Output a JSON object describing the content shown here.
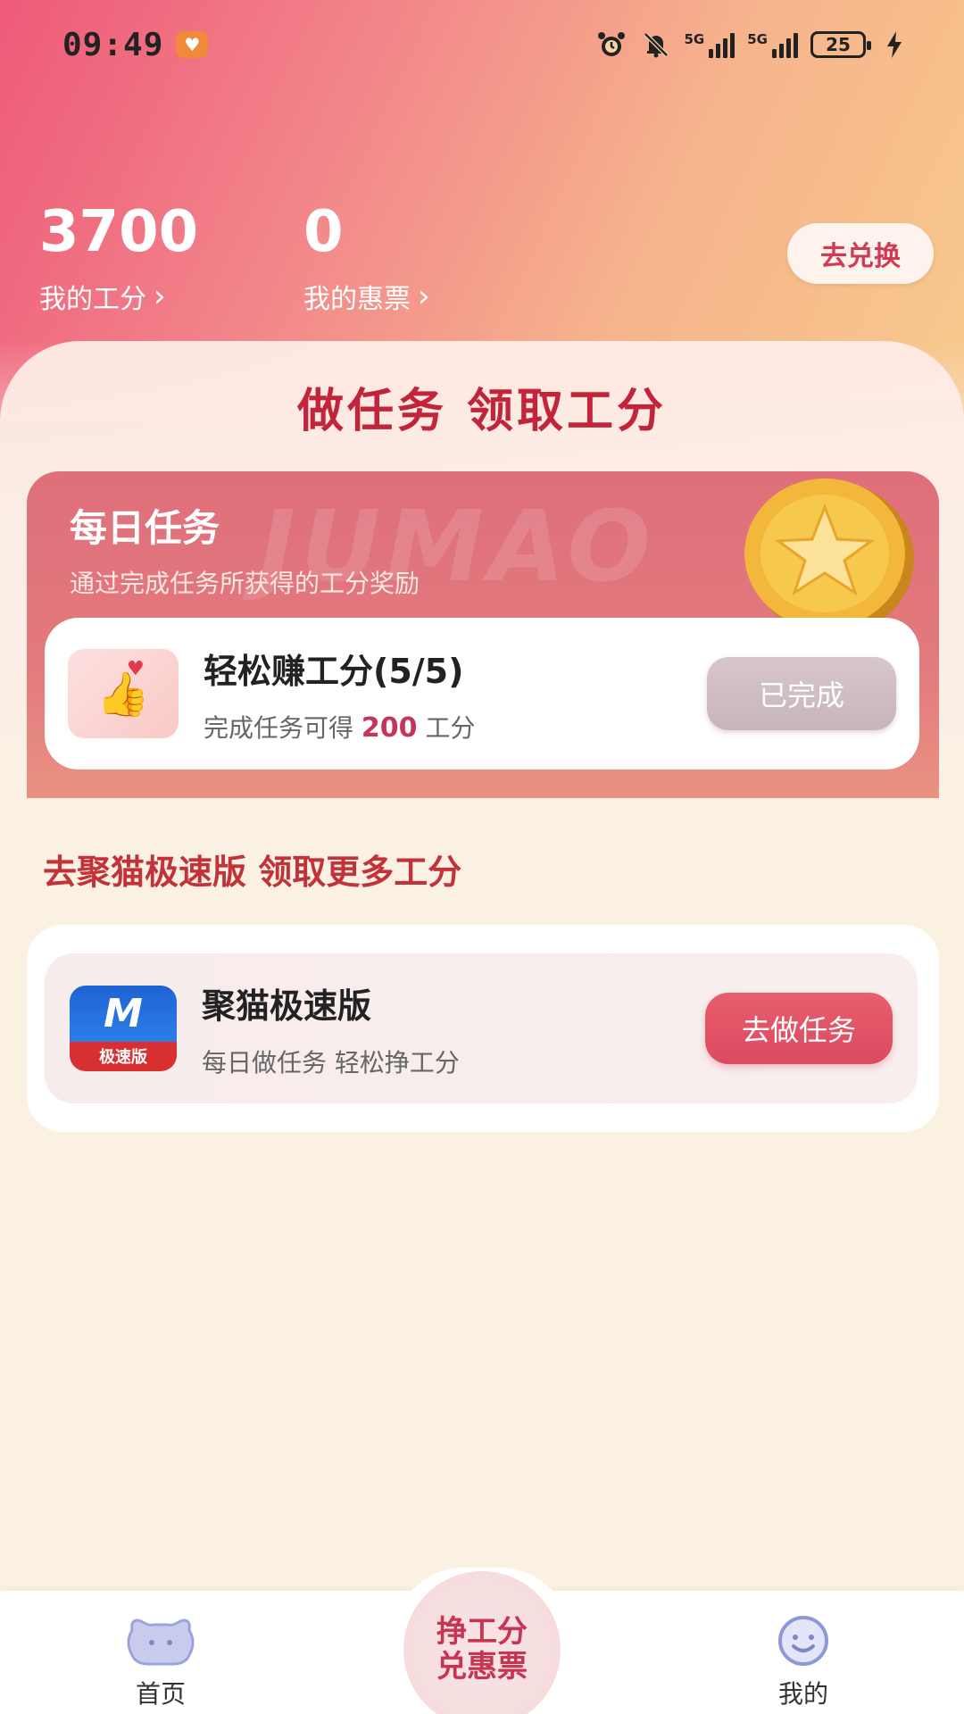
{
  "status_bar": {
    "time": "09:49",
    "network1": "5G",
    "network2": "5G",
    "battery": "25",
    "icons": [
      "alarm-icon",
      "mute-icon",
      "signal-icon",
      "battery-icon",
      "charging-icon"
    ]
  },
  "stats": {
    "work_points_value": "3700",
    "work_points_label": "我的工分",
    "tickets_value": "0",
    "tickets_label": "我的惠票",
    "exchange_button": "去兑换"
  },
  "main": {
    "title": "做任务 领取工分",
    "daily": {
      "title": "每日任务",
      "subtitle": "通过完成任务所获得的工分奖励",
      "watermark": "JUMAO"
    },
    "task": {
      "title": "轻松赚工分(5/5)",
      "desc_prefix": "完成任务可得",
      "points": "200",
      "desc_suffix": "工分",
      "button": "已完成"
    },
    "section_title": "去聚猫极速版 领取更多工分",
    "app": {
      "icon_letter": "M",
      "icon_tag": "极速版",
      "name": "聚猫极速版",
      "desc": "每日做任务 轻松挣工分",
      "button": "去做任务"
    }
  },
  "bottom_nav": {
    "home_label": "首页",
    "center_line1": "挣工分",
    "center_line2": "兑惠票",
    "mine_label": "我的"
  },
  "colors": {
    "accent_red": "#c2253a",
    "button_pink": "#dc4a5f",
    "background": "#fbf1e3"
  }
}
